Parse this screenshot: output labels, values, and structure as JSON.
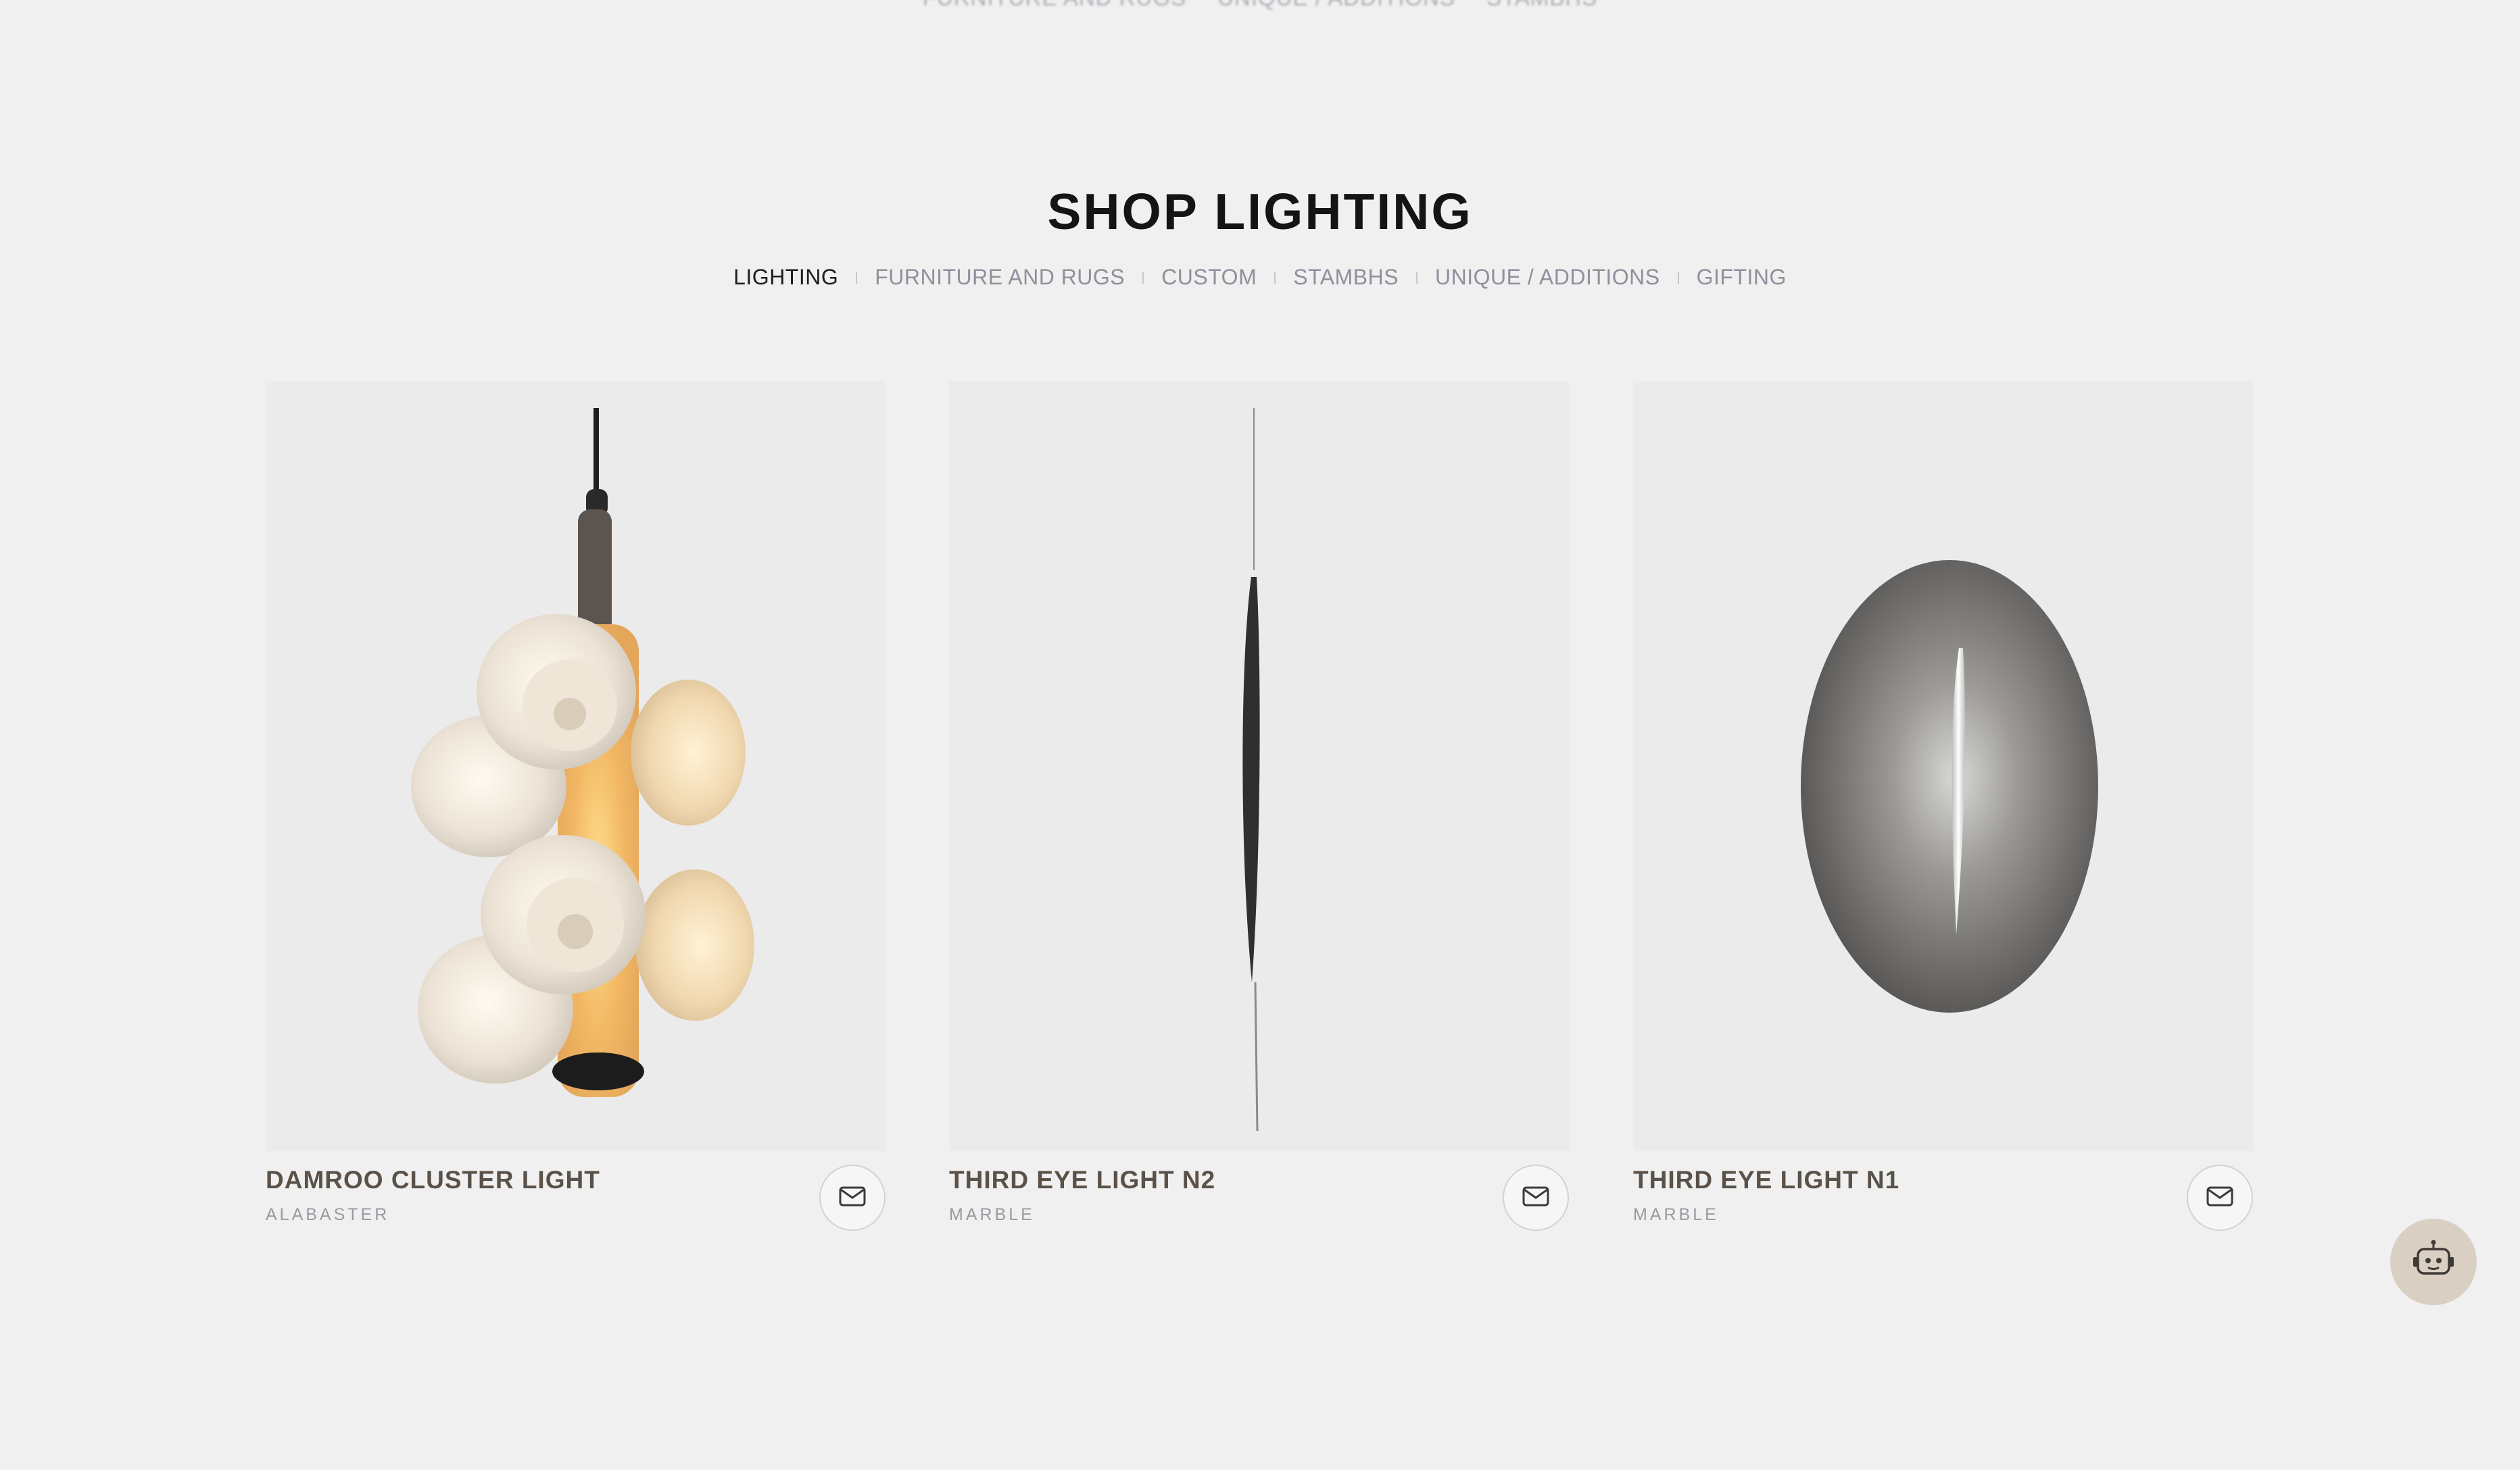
{
  "top_nav_ghost": {
    "items": [
      "FURNITURE AND RUGS",
      "UNIQUE / ADDITIONS",
      "STAMBHS"
    ]
  },
  "page": {
    "title": "SHOP LIGHTING"
  },
  "category_nav": {
    "tabs": [
      {
        "label": "LIGHTING",
        "active": true
      },
      {
        "label": "FURNITURE AND RUGS",
        "active": false
      },
      {
        "label": "CUSTOM",
        "active": false
      },
      {
        "label": "STAMBHS",
        "active": false
      },
      {
        "label": "UNIQUE / ADDITIONS",
        "active": false
      },
      {
        "label": "GIFTING",
        "active": false
      }
    ]
  },
  "products": [
    {
      "name": "DAMROO CLUSTER LIGHT",
      "material": "ALABASTER",
      "icon": "mail-icon"
    },
    {
      "name": "THIRD EYE LIGHT N2",
      "material": "MARBLE",
      "icon": "mail-icon"
    },
    {
      "name": "THIRD EYE LIGHT N1",
      "material": "MARBLE",
      "icon": "mail-icon"
    }
  ],
  "chat_widget": {
    "icon": "robot-icon"
  },
  "colors": {
    "background": "#eff0ef",
    "card_background": "#ebebeb",
    "product_name": "#5a5149",
    "chat_button": "#d9cfc2"
  }
}
